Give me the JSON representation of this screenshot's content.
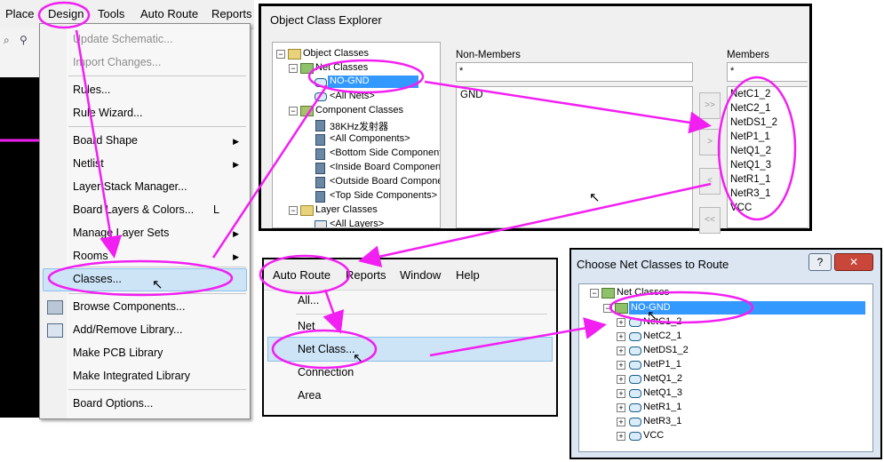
{
  "menubar": {
    "items": [
      "Place",
      "Design",
      "Tools",
      "Auto Route",
      "Reports"
    ]
  },
  "design_menu": {
    "items": [
      {
        "label": "Update Schematic...",
        "disabled": true
      },
      {
        "label": "Import Changes...",
        "disabled": true
      },
      {
        "label": "Rules..."
      },
      {
        "label": "Rule Wizard..."
      },
      {
        "label": "Board Shape",
        "submenu": true
      },
      {
        "label": "Netlist",
        "submenu": true
      },
      {
        "label": "Layer Stack Manager..."
      },
      {
        "label": "Board Layers & Colors...",
        "shortcut": "L"
      },
      {
        "label": "Manage Layer Sets",
        "submenu": true
      },
      {
        "label": "Rooms",
        "submenu": true
      },
      {
        "label": "Classes...",
        "highlighted": true
      },
      {
        "label": "Browse Components..."
      },
      {
        "label": "Add/Remove Library..."
      },
      {
        "label": "Make PCB Library"
      },
      {
        "label": "Make Integrated Library"
      },
      {
        "label": "Board Options..."
      }
    ]
  },
  "object_class_explorer": {
    "title": "Object Class Explorer",
    "tree": [
      {
        "label": "Object Classes"
      },
      {
        "label": "Net Classes"
      },
      {
        "label": "NO-GND",
        "selected": true
      },
      {
        "label": "<All Nets>"
      },
      {
        "label": "Component Classes"
      },
      {
        "label": "38KHz发射器"
      },
      {
        "label": "<All Components>"
      },
      {
        "label": "<Bottom Side Components>"
      },
      {
        "label": "<Inside Board Components>"
      },
      {
        "label": "<Outside Board Components>"
      },
      {
        "label": "<Top Side Components>"
      },
      {
        "label": "Layer Classes"
      },
      {
        "label": "<All Layers>"
      }
    ],
    "non_members_label": "Non-Members",
    "non_members_filter": "*",
    "non_members": [
      "GND"
    ],
    "members_label": "Members",
    "members_filter": "*",
    "members": [
      "NetC1_2",
      "NetC2_1",
      "NetDS1_2",
      "NetP1_1",
      "NetQ1_2",
      "NetQ1_3",
      "NetR1_1",
      "NetR3_1",
      "VCC"
    ],
    "buttons": [
      ">>",
      ">",
      "<",
      "<<"
    ]
  },
  "auto_route_menu": {
    "bar": [
      "Auto Route",
      "Reports",
      "Window",
      "Help"
    ],
    "items": [
      "All...",
      "Net",
      "Net Class...",
      "Connection",
      "Area"
    ],
    "highlighted": "Net Class..."
  },
  "choose_net_classes": {
    "title": "Choose Net Classes to Route",
    "help_button": "?",
    "close_button": "✕",
    "root": "Net Classes",
    "selected": "NO-GND",
    "nets": [
      "NetC1_2",
      "NetC2_1",
      "NetDS1_2",
      "NetP1_1",
      "NetQ1_2",
      "NetQ1_3",
      "NetR1_1",
      "NetR3_1",
      "VCC"
    ]
  },
  "colors": {
    "annotation": "#f21ff2",
    "selection": "#3399ff",
    "menu_highlight": "#cde4f7"
  }
}
